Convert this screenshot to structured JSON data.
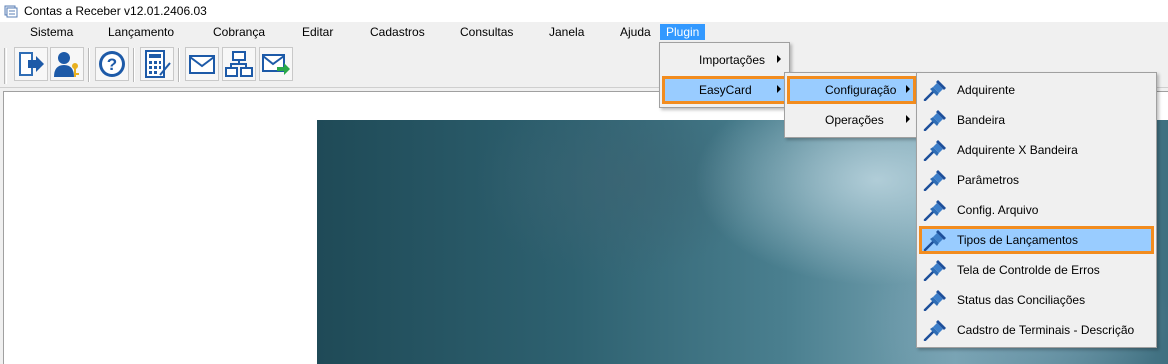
{
  "window": {
    "title": "Contas a Receber v12.01.2406.03"
  },
  "menubar": {
    "items": [
      "Sistema",
      "Lançamento",
      "Cobrança",
      "Editar",
      "Cadastros",
      "Consultas",
      "Janela",
      "Ajuda",
      "Plugin"
    ],
    "active": "Plugin"
  },
  "toolbar": {
    "buttons": [
      "exit-icon",
      "user-key-icon",
      "help-icon",
      "calculator-icon",
      "mail-inbox-icon",
      "network-icon",
      "mail-send-icon"
    ]
  },
  "plugin_menu": {
    "items": [
      {
        "label": "Importações",
        "has_submenu": true
      },
      {
        "label": "EasyCard",
        "has_submenu": true,
        "highlighted": true
      }
    ]
  },
  "easycard_menu": {
    "items": [
      {
        "label": "Configuração",
        "has_submenu": true,
        "highlighted": true
      },
      {
        "label": "Operações",
        "has_submenu": true
      }
    ]
  },
  "config_menu": {
    "icon": "pin-icon",
    "items": [
      {
        "label": "Adquirente"
      },
      {
        "label": "Bandeira"
      },
      {
        "label": "Adquirente X Bandeira"
      },
      {
        "label": "Parâmetros"
      },
      {
        "label": "Config. Arquivo"
      },
      {
        "label": "Tipos de Lançamentos",
        "highlighted": true
      },
      {
        "label": "Tela de Controlde de Erros"
      },
      {
        "label": "Status das Conciliações"
      },
      {
        "label": "Cadstro de Terminais - Descrição"
      }
    ]
  },
  "colors": {
    "highlight": "#99ccff",
    "outline": "#f28c1e",
    "menu_active": "#3399ff"
  }
}
